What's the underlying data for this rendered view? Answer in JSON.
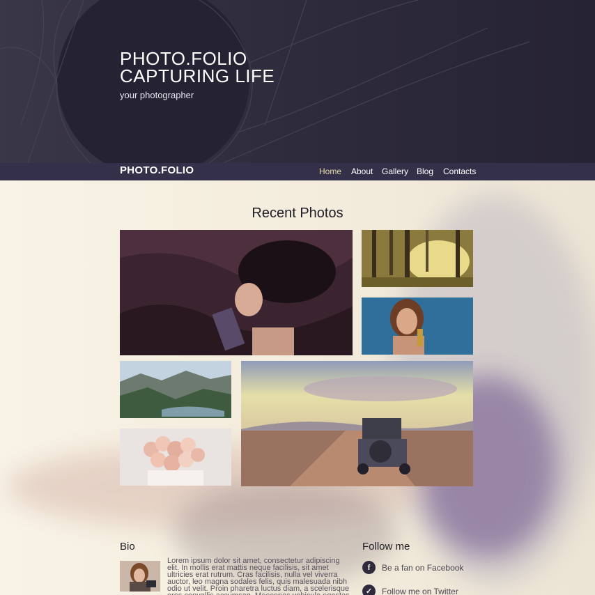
{
  "hero": {
    "title_line1": "PHOTO.FOLIO",
    "title_line2": "CAPTURING LIFE",
    "subtitle": "your photographer"
  },
  "nav": {
    "logo": "PHOTO.FOLIO",
    "items": [
      {
        "label": "Home",
        "active": true
      },
      {
        "label": "About",
        "active": false
      },
      {
        "label": "Gallery",
        "active": false
      },
      {
        "label": "Blog",
        "active": false
      },
      {
        "label": "Contacts",
        "active": false
      }
    ]
  },
  "gallery": {
    "title": "Recent Photos",
    "photos": [
      {
        "name": "woman-on-satin"
      },
      {
        "name": "sunlit-forest"
      },
      {
        "name": "woman-portrait-blue"
      },
      {
        "name": "mountain-lake"
      },
      {
        "name": "rose-bouquet"
      },
      {
        "name": "vintage-car-road"
      }
    ]
  },
  "bio": {
    "heading": "Bio",
    "text": "Lorem ipsum dolor sit amet, consectetur adipiscing elit. In mollis erat mattis neque facilisis, sit amet ultricies erat rutrum. Cras facilisis, nulla vel viverra auctor, leo magna sodales felis, quis malesuada nibh odio ut velit. Proin pharetra luctus diam, a scelerisque eros convallis accumsan. Maecenas vehicula egestas derto venenatis. Duis massa elit"
  },
  "follow": {
    "heading": "Follow me",
    "facebook_label": "Be a fan on Facebook",
    "twitter_label": "Follow me on Twitter",
    "facebook_icon": "facebook-icon",
    "twitter_icon": "twitter-icon"
  },
  "colors": {
    "header_bg": "#2f2c3d",
    "navbar_bg": "#34304a",
    "nav_active": "#e7dfa6",
    "content_bg": "#f7f1e6"
  }
}
